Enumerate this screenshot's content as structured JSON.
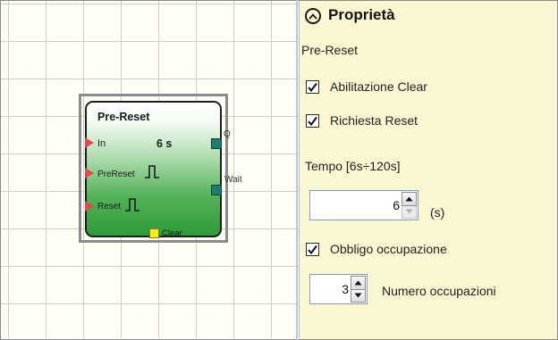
{
  "block": {
    "title": "Pre-Reset",
    "time": "6 s",
    "inputs": [
      "In",
      "PreReset",
      "Reset"
    ],
    "outputs": [
      "Q",
      "Wait"
    ],
    "clear_label": "Clear"
  },
  "panel": {
    "title": "Proprietà",
    "subtitle": "Pre-Reset",
    "enable_clear": {
      "label": "Abilitazione Clear",
      "checked": true
    },
    "reset_request": {
      "label": "Richiesta Reset",
      "checked": true
    },
    "time_label": "Tempo [6s÷120s]",
    "time_value": "6",
    "time_unit": "(s)",
    "occupation_required": {
      "label": "Obbligo occupazione",
      "checked": true
    },
    "occupation_count": {
      "value": "3",
      "label": "Numero occupazioni"
    }
  },
  "colors": {
    "panel_bg": "#fbf6d2",
    "canvas_bg": "#fffef4",
    "block_green": "#2e9a3a",
    "input_arrow": "#e54848",
    "output_port": "#1f7d6e",
    "clear_port": "#ffe81e"
  },
  "icons": [
    "collapse-up-icon",
    "checkmark-icon",
    "spin-up-icon",
    "spin-down-icon",
    "pulse-icon"
  ]
}
